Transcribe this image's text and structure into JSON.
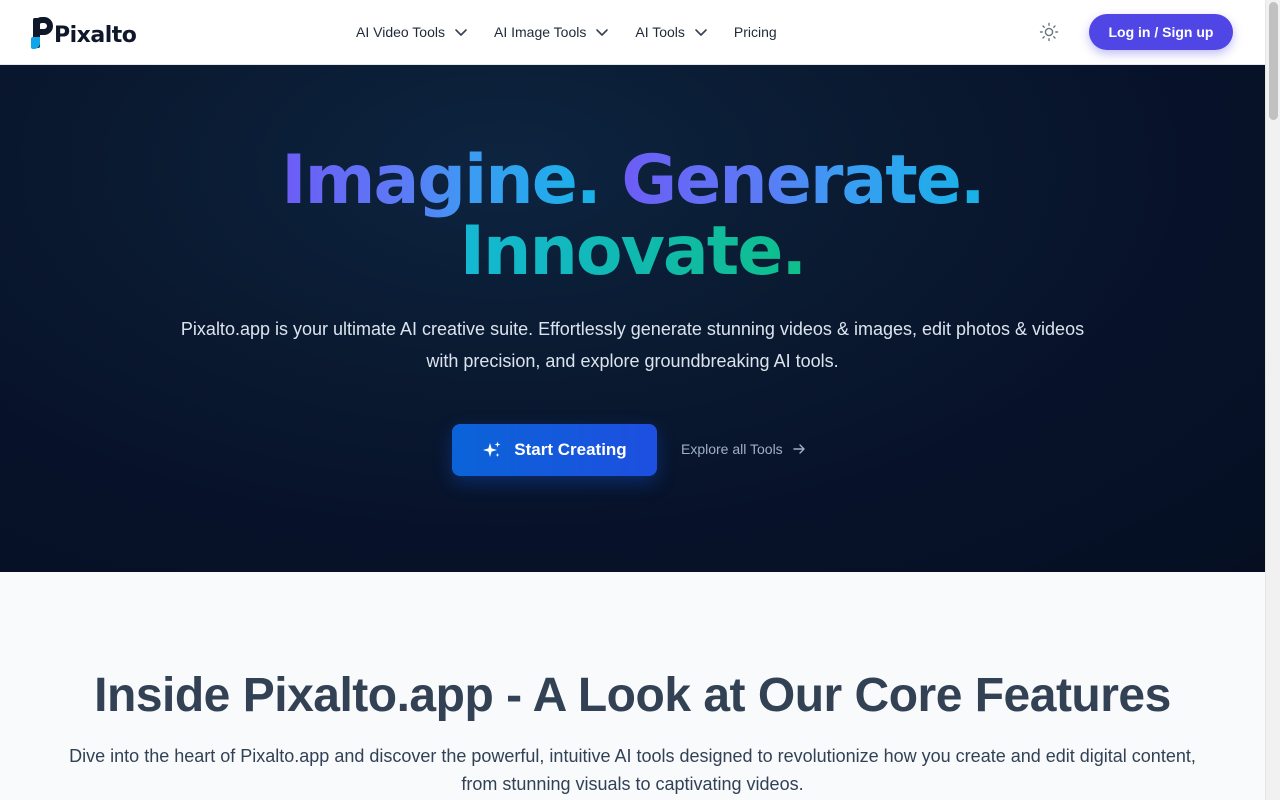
{
  "header": {
    "logo_text": "Pixalto",
    "nav": [
      {
        "label": "AI Video Tools",
        "has_dropdown": true
      },
      {
        "label": "AI Image Tools",
        "has_dropdown": true
      },
      {
        "label": "AI Tools",
        "has_dropdown": true
      },
      {
        "label": "Pricing",
        "has_dropdown": false
      }
    ],
    "theme_icon": "sun-icon",
    "login_label": "Log in / Sign up"
  },
  "hero": {
    "title_line1_part1": "Imagine.",
    "title_line1_part2": "Generate.",
    "title_line2": "Innovate.",
    "description": "Pixalto.app is your ultimate AI creative suite. Effortlessly generate stunning videos & images, edit photos & videos with precision, and explore groundbreaking AI tools.",
    "cta_primary": "Start Creating",
    "cta_secondary": "Explore all Tools"
  },
  "features": {
    "title": "Inside Pixalto.app - A Look at Our Core Features",
    "description": "Dive into the heart of Pixalto.app and discover the powerful, intuitive AI tools designed to revolutionize how you create and edit digital content, from stunning visuals to captivating videos."
  },
  "colors": {
    "accent": "#4f46e5",
    "hero_bg": "#07122a",
    "cta_blue": "#1d4fe0"
  }
}
